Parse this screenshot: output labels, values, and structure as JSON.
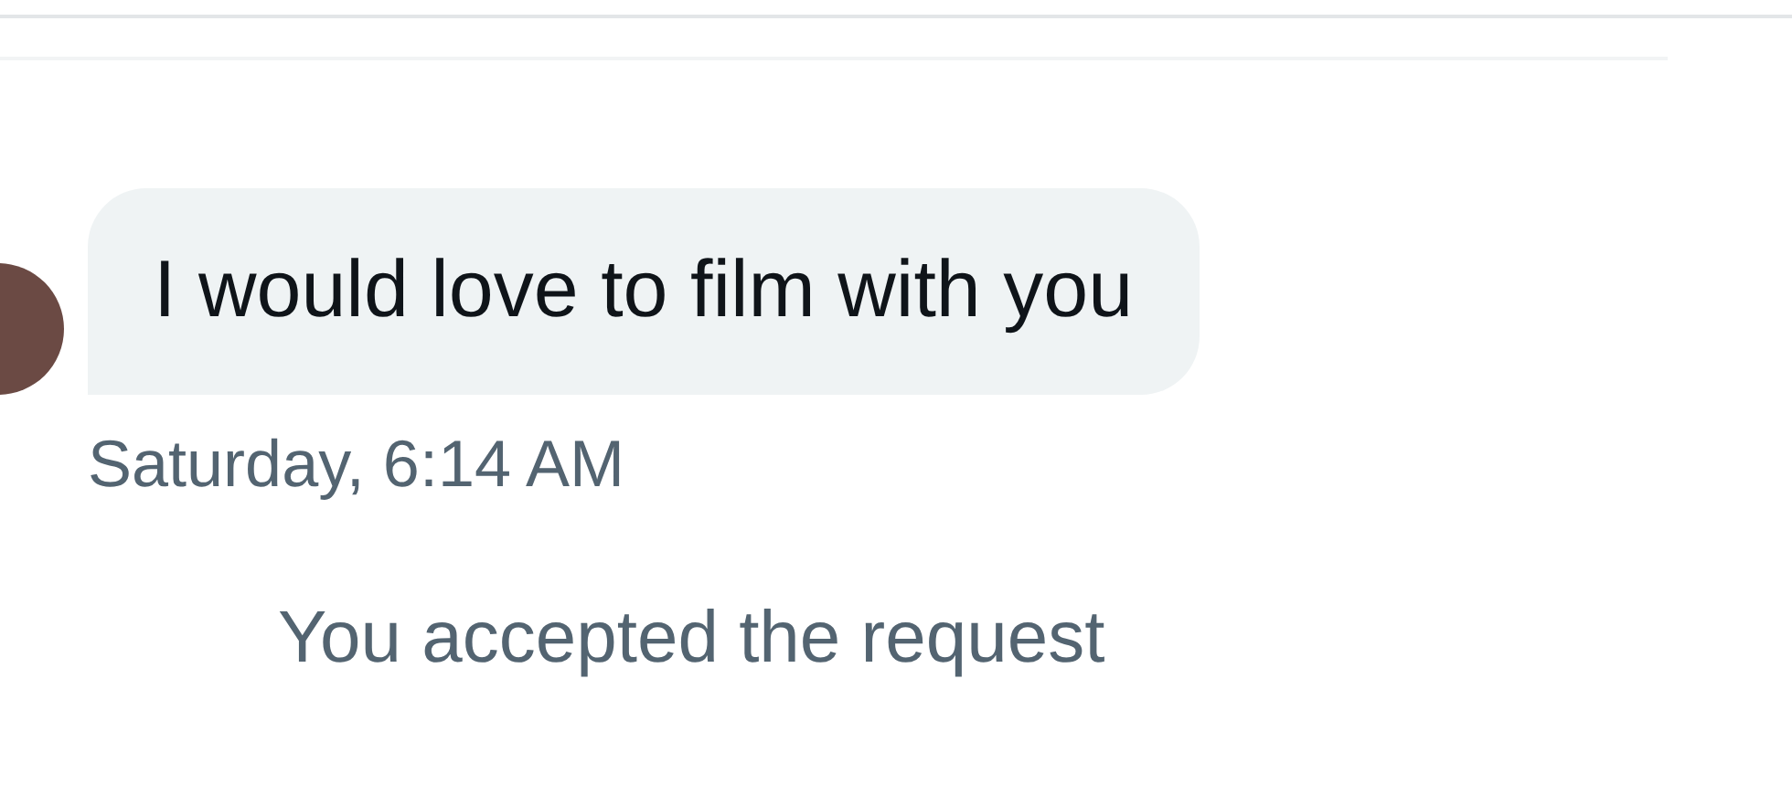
{
  "message": {
    "text": "I would love to film with you",
    "timestamp": "Saturday, 6:14 AM"
  },
  "system_notice": "You accepted the request"
}
